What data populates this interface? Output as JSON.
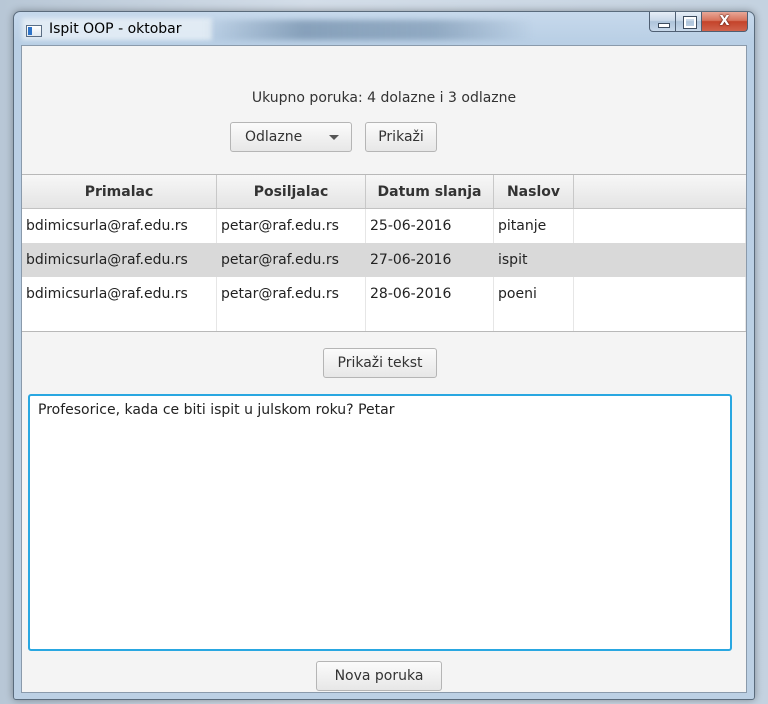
{
  "window": {
    "title": "Ispit OOP - oktobar",
    "close_glyph": "X"
  },
  "summary": "Ukupno poruka: 4 dolazne i 3 odlazne",
  "filter": {
    "selected": "Odlazne",
    "show_label": "Prikaži"
  },
  "table": {
    "columns": [
      "Primalac",
      "Posiljalac",
      "Datum slanja",
      "Naslov"
    ],
    "rows": [
      [
        "bdimicsurla@raf.edu.rs",
        "petar@raf.edu.rs",
        "25-06-2016",
        "pitanje"
      ],
      [
        "bdimicsurla@raf.edu.rs",
        "petar@raf.edu.rs",
        "27-06-2016",
        "ispit"
      ],
      [
        "bdimicsurla@raf.edu.rs",
        "petar@raf.edu.rs",
        "28-06-2016",
        "poeni"
      ]
    ],
    "selected_row": 1
  },
  "show_text_label": "Prikaži tekst",
  "message_text": "Profesorice, kada ce biti ispit u julskom roku? Petar",
  "new_message_label": "Nova poruka",
  "colors": {
    "focus_border": "#29a7e1",
    "selected_row": "#d9d9d9",
    "close_button": "#c4432a"
  }
}
